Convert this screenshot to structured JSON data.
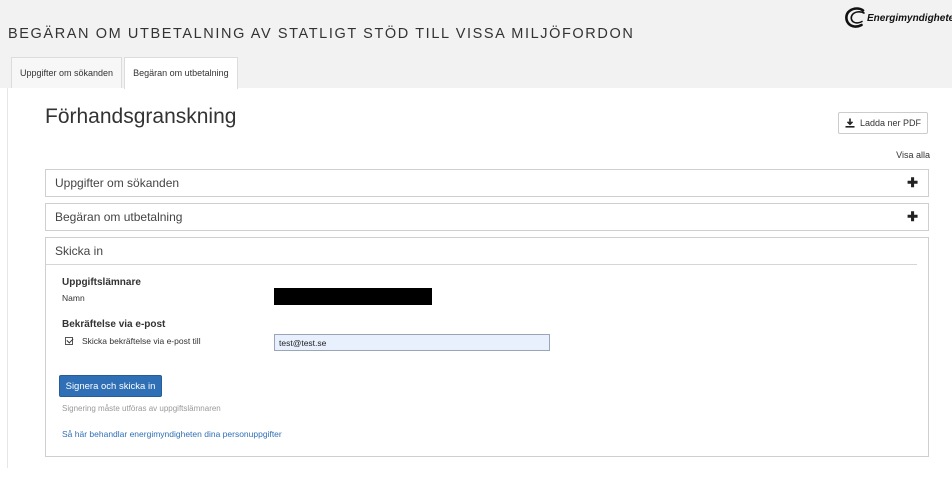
{
  "header": {
    "title": "BEGÄRAN OM UTBETALNING AV STATLIGT STÖD TILL VISSA MILJÖFORDON",
    "logo_text": "Energimyndigheten",
    "logo_icon": "energimyndigheten-logo-icon"
  },
  "tabs": [
    {
      "label": "Uppgifter om sökanden",
      "active": false
    },
    {
      "label": "Begäran om utbetalning",
      "active": true
    }
  ],
  "main": {
    "title": "Förhandsgranskning",
    "download_pdf_label": "Ladda ner PDF",
    "download_icon": "download-icon",
    "show_all_label": "Visa alla"
  },
  "panels": [
    {
      "title": "Uppgifter om sökanden",
      "expanded": false,
      "toggle_symbol": "✚"
    },
    {
      "title": "Begäran om utbetalning",
      "expanded": false,
      "toggle_symbol": "✚"
    },
    {
      "title": "Skicka in",
      "expanded": true
    }
  ],
  "submit": {
    "reporter_heading": "Uppgiftslämnare",
    "name_label": "Namn",
    "confirmation_heading": "Bekräftelse via e-post",
    "checkbox_label": "Skicka bekräftelse via e-post till",
    "checkbox_checked": true,
    "email_value": "test@test.se",
    "sign_button_label": "Signera och skicka in",
    "hint": "Signering måste utföras av uppgiftslämnaren",
    "privacy_link": "Så här behandlar energimyndigheten dina personuppgifter"
  },
  "colors": {
    "primary": "#2f6fb5",
    "header_bg": "#f2f2f2",
    "input_bg": "#e8f0fe"
  }
}
